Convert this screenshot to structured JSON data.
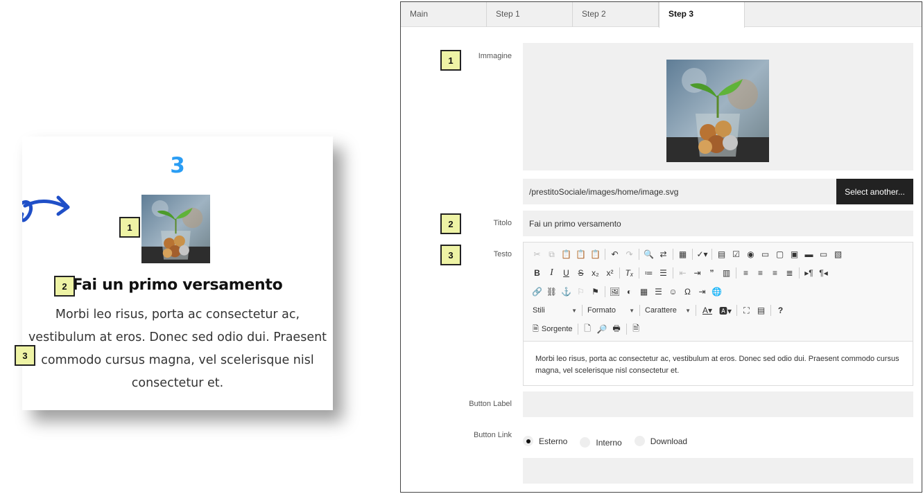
{
  "preview": {
    "step_number": "3",
    "title": "Fai un primo versamento",
    "text": "Morbi leo risus, porta ac consectetur ac, vestibulum at eros. Donec sed odio dui. Praesent commodo cursus magna, vel scelerisque nisl consectetur et."
  },
  "markers": [
    "1",
    "2",
    "3"
  ],
  "tabs": [
    {
      "label": "Main",
      "active": false
    },
    {
      "label": "Step 1",
      "active": false
    },
    {
      "label": "Step 2",
      "active": false
    },
    {
      "label": "Step 3",
      "active": true
    }
  ],
  "form": {
    "image_label": "Immagine",
    "image_path": "/prestitoSociale/images/home/image.svg",
    "select_button": "Select another...",
    "title_label": "Titolo",
    "title_value": "Fai un primo versamento",
    "text_label": "Testo",
    "text_value": "Morbi leo risus, porta ac consectetur ac, vestibulum at eros. Donec sed odio dui. Praesent commodo cursus magna, vel scelerisque nisl consectetur et.",
    "button_label_label": "Button Label",
    "button_label_value": "",
    "button_link_label": "Button Link",
    "button_link_options": [
      {
        "label": "Esterno",
        "checked": true
      },
      {
        "label": "Interno",
        "checked": false
      },
      {
        "label": "Download",
        "checked": false
      }
    ],
    "button_link_value": ""
  },
  "toolbar": {
    "styles_combo": "Stili",
    "format_combo": "Formato",
    "font_combo": "Carattere",
    "source_button": "Sorgente"
  },
  "colors": {
    "accent": "#2a9df4",
    "marker_fill": "#eef3a5",
    "button_dark": "#222222"
  }
}
